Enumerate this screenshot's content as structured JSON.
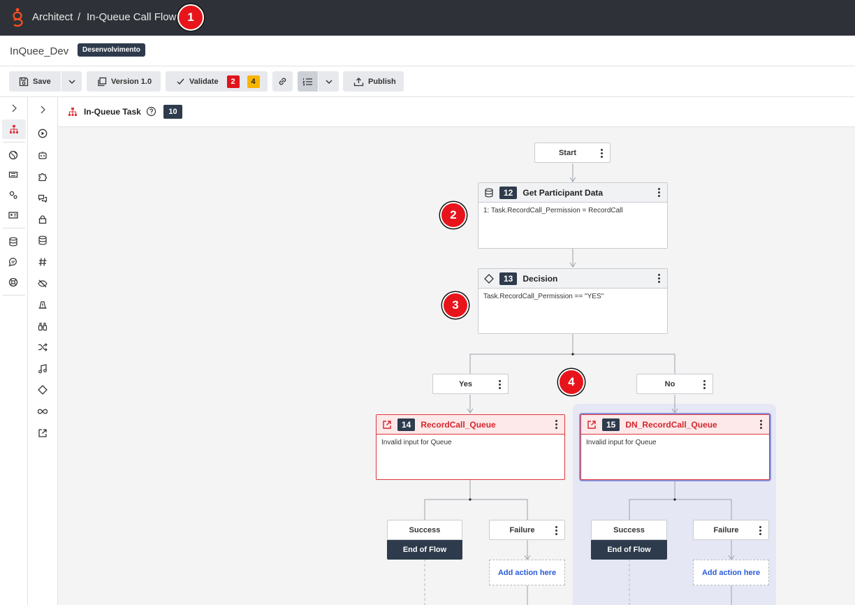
{
  "topbar": {
    "breadcrumb_root": "Architect",
    "breadcrumb_sep": "/",
    "breadcrumb_current": "In-Queue Call Flow",
    "marker": "1"
  },
  "titlerow": {
    "flow_name": "InQuee_Dev",
    "env_badge": "Desenvolvimento"
  },
  "toolbar": {
    "save": "Save",
    "version": "Version 1.0",
    "validate": "Validate",
    "errors": "2",
    "warnings": "4",
    "publish": "Publish"
  },
  "task": {
    "title": "In-Queue Task",
    "count": "10"
  },
  "flow": {
    "start": "Start",
    "get_participant": {
      "num": "12",
      "title": "Get Participant Data",
      "body": "1: Task.RecordCall_Permission = RecordCall",
      "marker": "2"
    },
    "decision": {
      "num": "13",
      "title": "Decision",
      "body": "Task.RecordCall_Permission == \"YES\"",
      "marker": "3"
    },
    "branch_yes": "Yes",
    "branch_no": "No",
    "branch_marker": "4",
    "queue_left": {
      "num": "14",
      "title": "RecordCall_Queue",
      "body": "Invalid input for Queue"
    },
    "queue_right": {
      "num": "15",
      "title": "DN_RecordCall_Queue",
      "body": "Invalid input for Queue"
    },
    "success": "Success",
    "failure": "Failure",
    "end_of_flow": "End of Flow",
    "add_action": "Add action here"
  },
  "colors": {
    "topbar_bg": "#2e3238",
    "marker_red": "#e8141b",
    "error_red": "#e0343a",
    "badge_dark": "#2e3b4c",
    "warning_yellow": "#f7b500",
    "link_blue": "#2a5bd7",
    "selection_bg": "#e6e7f4"
  }
}
